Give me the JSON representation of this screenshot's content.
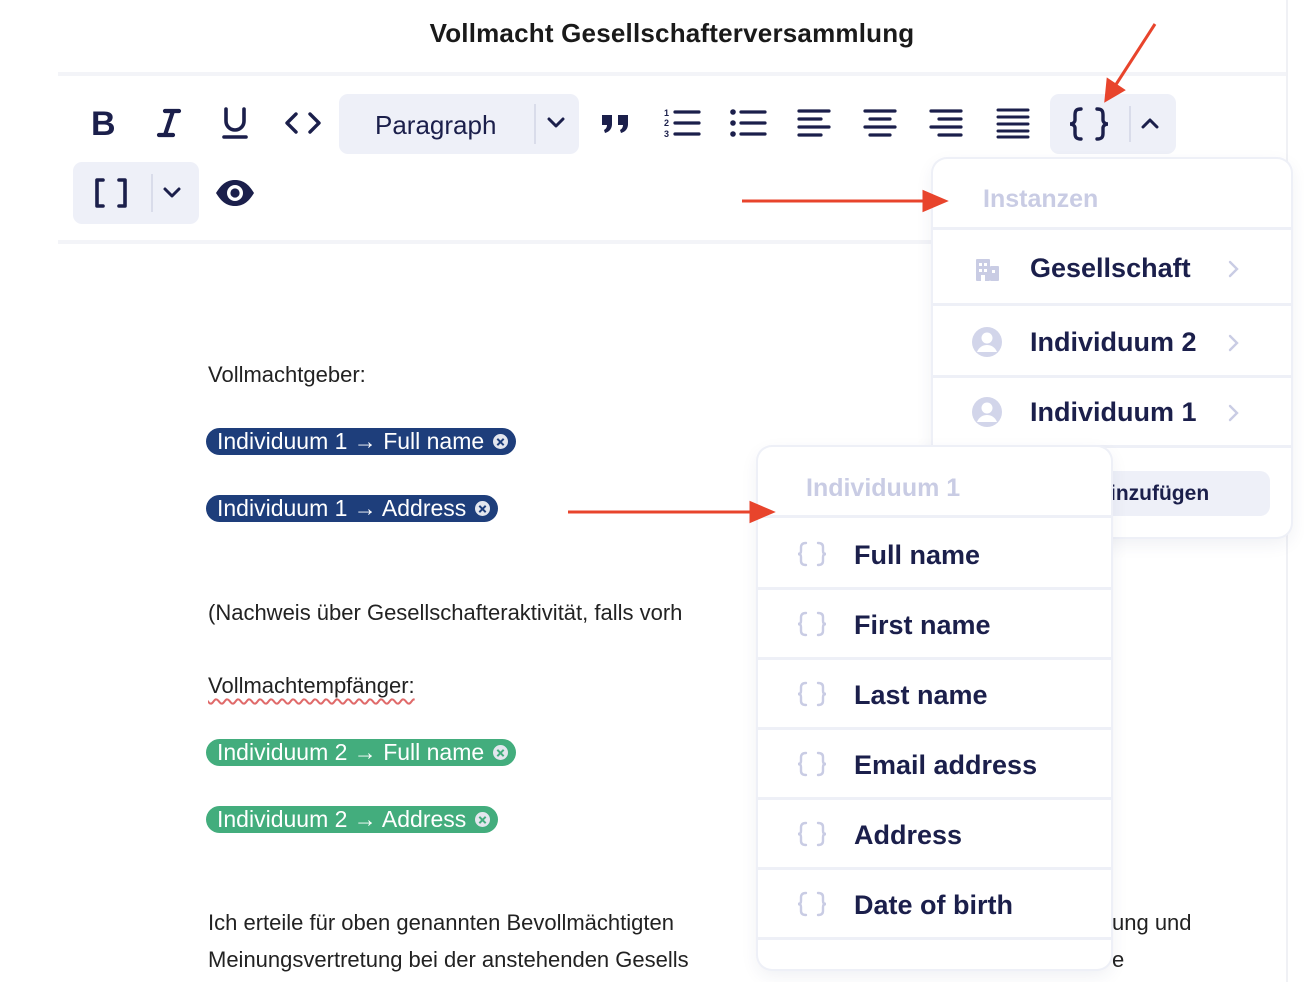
{
  "title": "Vollmacht Gesellschafterversammlung",
  "toolbar": {
    "paragraph_label": "Paragraph"
  },
  "document": {
    "line1": "Vollmachtgeber:",
    "chip1": "Individuum 1 → Full name",
    "chip2": "Individuum 1 → Address",
    "line2": "(Nachweis über Gesellschafteraktivität, falls vorh",
    "line3": "Vollmachtempfänger:",
    "chip3": "Individuum 2 → Full name",
    "chip4": "Individuum 2 → Address",
    "line4a": "Ich erteile für oben genannten Bevollmächtigten",
    "line4b": "ung und",
    "line5a": "Meinungsvertretung bei der anstehenden Gesells",
    "line5b": "e"
  },
  "instances_menu": {
    "header": "Instanzen",
    "items": [
      "Gesellschaft",
      "Individuum 2",
      "Individuum 1"
    ],
    "add_label": "inzufügen"
  },
  "fields_menu": {
    "header": "Individuum 1",
    "items": [
      "Full name",
      "First name",
      "Last name",
      "Email address",
      "Address",
      "Date of birth"
    ]
  },
  "colors": {
    "accent_navy": "#1b1f4b",
    "chip_blue": "#1e3e7b",
    "chip_green": "#43ad7d",
    "arrow_red": "#e8442c",
    "muted": "#c9cce4"
  }
}
